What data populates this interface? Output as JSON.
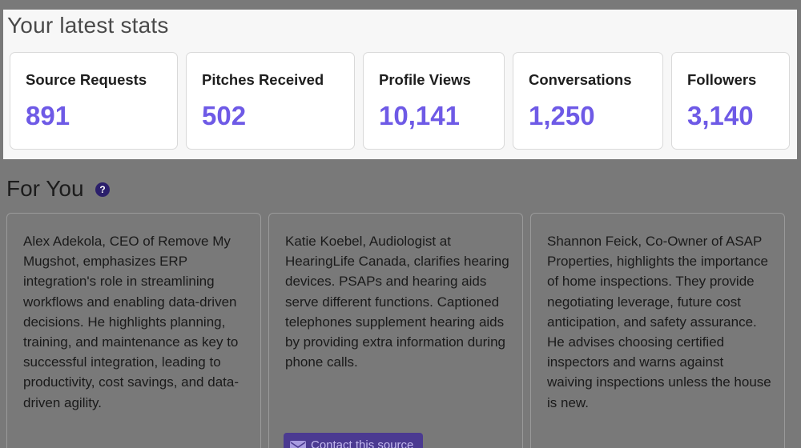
{
  "stats": {
    "title": "Your latest stats",
    "cards": [
      {
        "label": "Source Requests",
        "value": "891"
      },
      {
        "label": "Pitches Received",
        "value": "502"
      },
      {
        "label": "Profile Views",
        "value": "10,141"
      },
      {
        "label": "Conversations",
        "value": "1,250"
      },
      {
        "label": "Followers",
        "value": "3,140"
      }
    ]
  },
  "for_you": {
    "title": "For You",
    "help_icon": "?",
    "cards": [
      {
        "text": "Alex Adekola, CEO of Remove My Mugshot, emphasizes ERP integration's role in streamlining workflows and enabling data-driven decisions. He highlights planning, training, and maintenance as key to successful integration, leading to productivity, cost savings, and data-driven agility."
      },
      {
        "text": "Katie Koebel, Audiologist at HearingLife Canada, clarifies hearing devices. PSAPs and hearing aids serve different functions. Captioned telephones supplement hearing aids by providing extra information during phone calls.",
        "button": "Contact this source"
      },
      {
        "text": "Shannon Feick, Co-Owner of ASAP Properties, highlights the importance of home inspections. They provide negotiating leverage, future cost anticipation, and safety assurance. He advises choosing certified inspectors and warns against waiving inspections unless the house is new."
      }
    ]
  },
  "colors": {
    "accent": "#6e5ae6",
    "overlay": "#797979",
    "button": "#4b3a91"
  },
  "icons": {
    "help": "question-circle-icon",
    "contact": "mail-icon"
  }
}
